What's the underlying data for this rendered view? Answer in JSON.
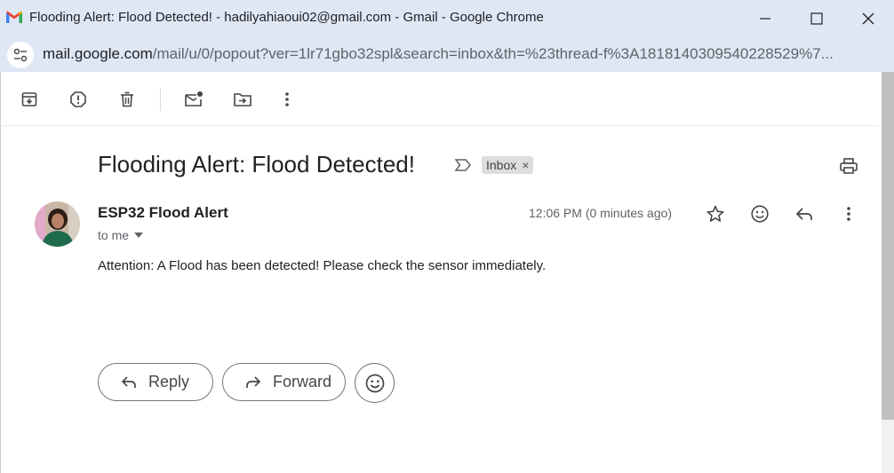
{
  "window": {
    "title": "Flooding Alert: Flood Detected! - hadilyahiaoui02@gmail.com - Gmail - Google Chrome",
    "icon": "gmail-icon",
    "controls": [
      "minimize-icon",
      "maximize-icon",
      "close-icon"
    ]
  },
  "address_bar": {
    "host": "mail.google.com",
    "path": "/mail/u/0/popout?ver=1lr71gbo32spl&search=inbox&th=%23thread-f%3A1818140309540228529%7..."
  },
  "toolbar": {
    "icons": [
      "archive-icon",
      "report-spam-icon",
      "delete-icon",
      "mark-unread-icon",
      "move-to-icon",
      "more-icon"
    ]
  },
  "email": {
    "subject": "Flooding Alert: Flood Detected!",
    "label": "Inbox",
    "label_remove": "×",
    "sender": "ESP32 Flood Alert",
    "recipient": "to me",
    "time": "12:06 PM (0 minutes ago)",
    "body": "Attention: A Flood has been detected! Please check the sensor immediately."
  },
  "actions": {
    "reply_label": "Reply",
    "forward_label": "Forward"
  },
  "colors": {
    "chrome_frame": "#dfe7f5",
    "chip_bg": "#dddddd",
    "text_primary": "#202124",
    "text_secondary": "#5f6368"
  }
}
